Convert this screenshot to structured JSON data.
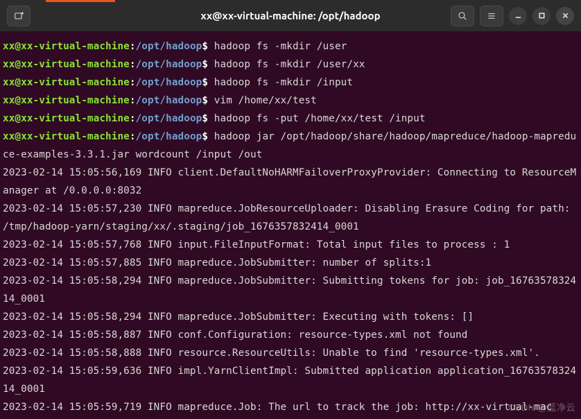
{
  "window": {
    "title": "xx@xx-virtual-machine: /opt/hadoop"
  },
  "prompt": {
    "user_host": "xx@xx-virtual-machine",
    "colon": ":",
    "path": "/opt/hadoop",
    "symbol": "$"
  },
  "commands": [
    "hadoop fs -mkdir /user",
    "hadoop fs -mkdir /user/xx",
    "hadoop fs -mkdir /input",
    "vim /home/xx/test",
    "hadoop fs -put /home/xx/test /input",
    "hadoop jar /opt/hadoop/share/hadoop/mapreduce/hadoop-mapreduce-examples-3.3.1.jar wordcount /input /out"
  ],
  "log_lines": [
    "2023-02-14 15:05:56,169 INFO client.DefaultNoHARMFailoverProxyProvider: Connecting to ResourceManager at /0.0.0.0:8032",
    "2023-02-14 15:05:57,230 INFO mapreduce.JobResourceUploader: Disabling Erasure Coding for path: /tmp/hadoop-yarn/staging/xx/.staging/job_1676357832414_0001",
    "2023-02-14 15:05:57,768 INFO input.FileInputFormat: Total input files to process : 1",
    "2023-02-14 15:05:57,885 INFO mapreduce.JobSubmitter: number of splits:1",
    "2023-02-14 15:05:58,294 INFO mapreduce.JobSubmitter: Submitting tokens for job: job_1676357832414_0001",
    "2023-02-14 15:05:58,294 INFO mapreduce.JobSubmitter: Executing with tokens: []",
    "2023-02-14 15:05:58,887 INFO conf.Configuration: resource-types.xml not found",
    "2023-02-14 15:05:58,888 INFO resource.ResourceUtils: Unable to find 'resource-types.xml'.",
    "2023-02-14 15:05:59,636 INFO impl.YarnClientImpl: Submitted application application_1676357832414_0001",
    "2023-02-14 15:05:59,719 INFO mapreduce.Job: The url to track the job: http://xx-virtual-mac"
  ],
  "icons": {
    "new_tab": "new-tab-icon",
    "search": "search-icon",
    "menu": "menu-icon",
    "minimize": "minimize-icon",
    "maximize": "maximize-icon",
    "close": "close-icon"
  },
  "watermark": "CSDN @蓝净云"
}
